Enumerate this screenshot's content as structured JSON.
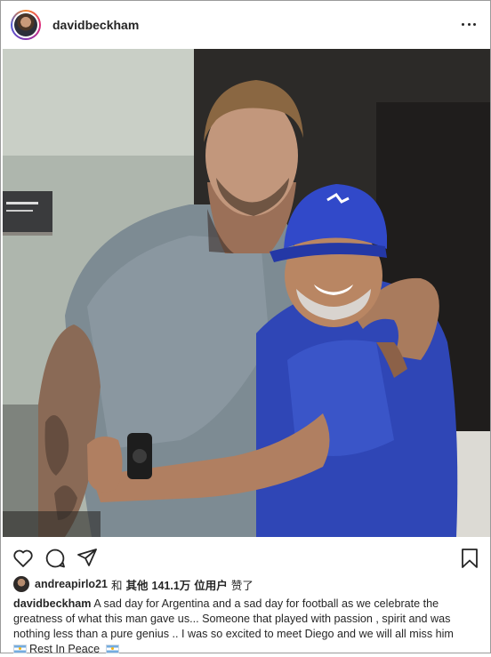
{
  "post": {
    "username": "davidbeckham",
    "more_icon": "more-horizontal-icon",
    "image_alt": "David Beckham hugging Diego Maradona in a lounge",
    "actions": {
      "like_icon": "heart-icon",
      "comment_icon": "comment-icon",
      "share_icon": "paper-plane-icon",
      "save_icon": "bookmark-icon"
    },
    "likes": {
      "user": "andreapirlo21",
      "and_text": "和",
      "others_text": "其他",
      "count": "141.1万",
      "suffix_text": "位用户",
      "liked_text": "赞了"
    },
    "caption": {
      "author": "davidbeckham",
      "text": "A sad day for Argentina and a sad day for football as we celebrate the greatness of what this man gave us... Someone that played with passion , spirit and was nothing less than a pure genius .. I was so excited to meet Diego and we will all miss him",
      "line_2": "Rest In Peace",
      "flag_icon": "argentina-flag-icon"
    }
  },
  "colors": {
    "text": "#262626",
    "border": "#9a9a9a",
    "flag_blue": "#74acdf",
    "cap_blue": "#2f4fd0"
  }
}
